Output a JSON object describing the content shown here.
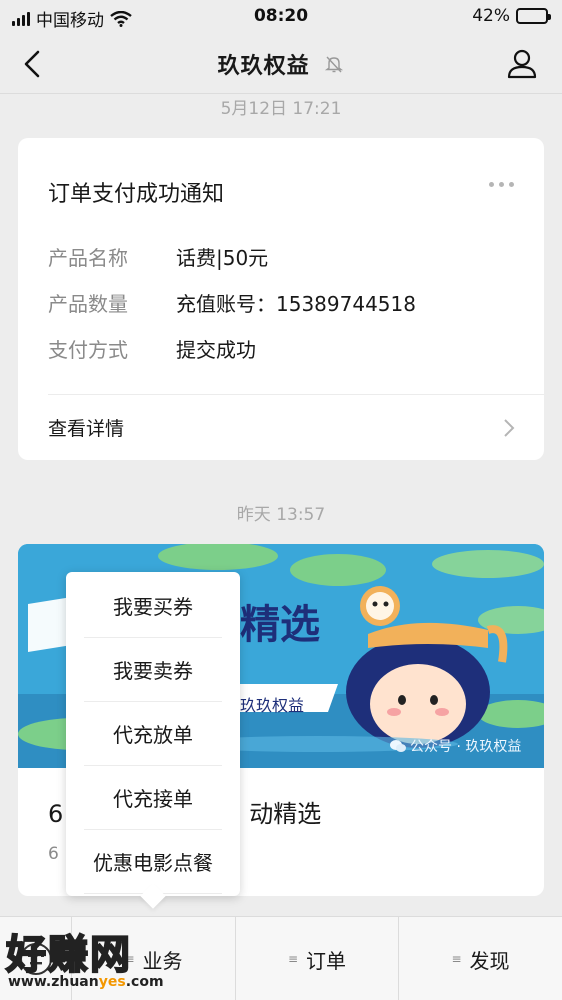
{
  "status_bar": {
    "carrier": "中国移动",
    "time": "08:20",
    "battery": "42%",
    "battery_level": 0.42
  },
  "header": {
    "title": "玖玖权益"
  },
  "messages": {
    "ts1": "5月12日 17:21",
    "ts2": "昨天 13:57"
  },
  "order_card": {
    "title": "订单支付成功通知",
    "rows": [
      {
        "key": "产品名称",
        "value": "话费|50元"
      },
      {
        "key": "产品数量",
        "value": "充值账号：15389744518"
      },
      {
        "key": "支付方式",
        "value": "提交成功"
      }
    ],
    "detail_label": "查看详情"
  },
  "article_card": {
    "banner_title": "精选",
    "banner_tag": "玖玖权益",
    "banner_caption": "公众号 · 玖玖权益",
    "title_prefix": "6",
    "title_suffix": "动精选",
    "date_prefix": "6"
  },
  "popup_menu": {
    "items": [
      "我要买券",
      "我要卖券",
      "代充放单",
      "代充接单",
      "优惠电影点餐"
    ]
  },
  "bottom_menu": {
    "tabs": [
      "业务",
      "订单",
      "发现"
    ]
  },
  "watermark": {
    "brand": "好赚网",
    "url_a": "www.zhuan",
    "url_b": "yes",
    "url_c": ".com"
  }
}
